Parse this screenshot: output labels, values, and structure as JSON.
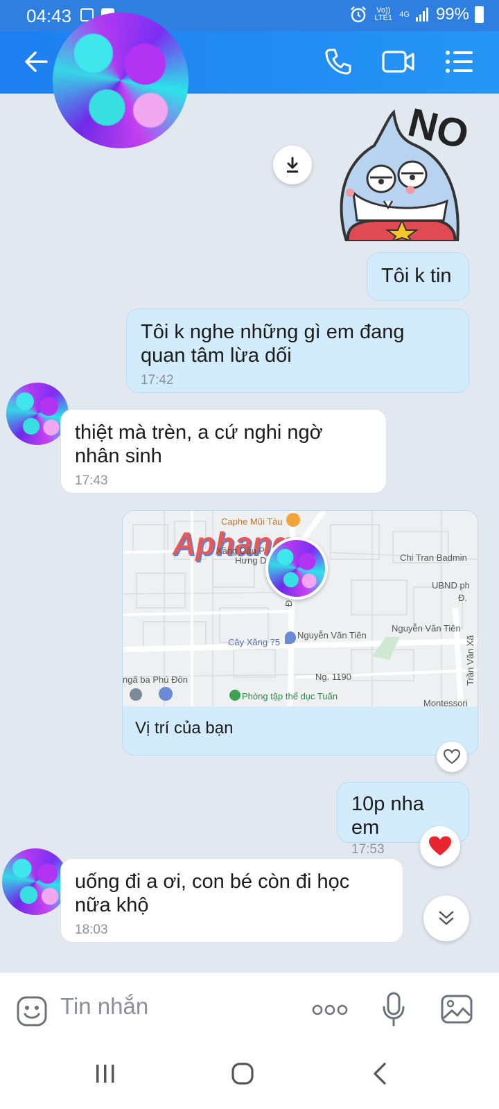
{
  "status_bar": {
    "time": "04:43",
    "signal_text": "Vo)) LTE1",
    "network": "4G",
    "battery": "99%"
  },
  "header": {
    "icons": [
      "back-icon",
      "phone-icon",
      "video-call-icon",
      "menu-list-icon"
    ]
  },
  "sticker": {
    "text": "NO"
  },
  "messages": [
    {
      "side": "mine",
      "text": "Tôi k tin",
      "time": ""
    },
    {
      "side": "mine",
      "text": "Tôi k nghe những gì em đang quan tâm lừa dối",
      "time": "17:42"
    },
    {
      "side": "theirs",
      "text": "thiệt mà trèn, a cứ nghi ngờ nhân sinh",
      "time": "17:43"
    },
    {
      "side": "mine",
      "type": "location",
      "caption": "Vị trí của bạn"
    },
    {
      "side": "mine",
      "text": "10p nha em",
      "time": "17:53"
    },
    {
      "side": "theirs",
      "text": "uống đi a ơi, con bé còn đi học nữa khộ",
      "time": "18:03"
    }
  ],
  "map": {
    "watermark": "Aphang",
    "labels": {
      "cafe": "Caphe Mũi Tàu",
      "gas1": "Xăng Dầu P",
      "gas1b": "Hưng D",
      "badminton": "Chi Tran Badmin",
      "ubnd": "UBND ph",
      "street_d": "Đ. Đồ",
      "gas2": "Cây Xăng 75",
      "street1": "Nguyễn Văn Tiên",
      "street2": "Nguyễn Văn Tiên",
      "ng": "Ng. 1190",
      "tran": "Trần Văn Xã",
      "phudon": "ngã ba Phú Đôn",
      "gym": "Phòng tập thể dục Tuấn",
      "montessori": "Montessori",
      "d_right": "Đ."
    }
  },
  "composer": {
    "placeholder": "Tin nhắn"
  },
  "colors": {
    "header": "#1e7ff0",
    "my_bubble": "#d3ecfc",
    "background": "#e2e8f0"
  }
}
